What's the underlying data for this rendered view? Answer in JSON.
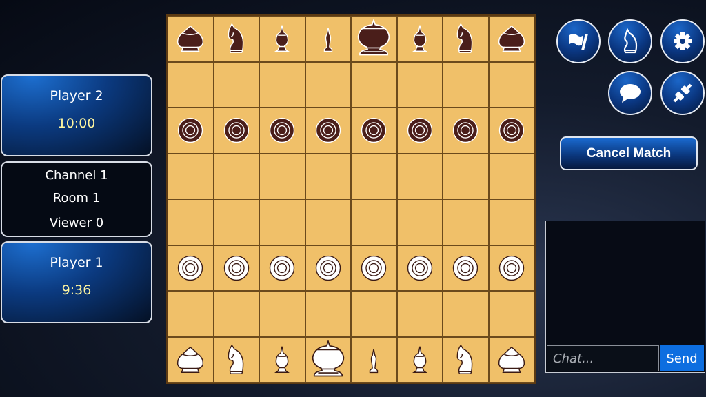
{
  "player2": {
    "name": "Player 2",
    "time": "10:00"
  },
  "room": {
    "channel": "Channel 1",
    "room": "Room 1",
    "viewers": "Viewer 0"
  },
  "player1": {
    "name": "Player 1",
    "time": "9:36"
  },
  "buttons": [
    {
      "icon": "flag-icon"
    },
    {
      "icon": "knight-icon"
    },
    {
      "icon": "gear-icon"
    },
    {
      "icon": "chat-bubble-icon"
    },
    {
      "icon": "disconnect-plug-icon"
    }
  ],
  "cancel_label": "Cancel Match",
  "chat": {
    "placeholder": "Chat...",
    "value": "",
    "send_label": "Send"
  },
  "colors": {
    "board": "#f0c069",
    "dark_piece": "#4a1e1a",
    "light_piece": "#ffffff",
    "accent": "#0d6ee0"
  },
  "board": [
    [
      "bR",
      "bN",
      "bB",
      "bQ",
      "bK",
      "bB",
      "bN",
      "bR"
    ],
    [
      "",
      "",
      "",
      "",
      "",
      "",
      "",
      ""
    ],
    [
      "bP",
      "bP",
      "bP",
      "bP",
      "bP",
      "bP",
      "bP",
      "bP"
    ],
    [
      "",
      "",
      "",
      "",
      "",
      "",
      "",
      ""
    ],
    [
      "",
      "",
      "",
      "",
      "",
      "",
      "",
      ""
    ],
    [
      "wP",
      "wP",
      "wP",
      "wP",
      "wP",
      "wP",
      "wP",
      "wP"
    ],
    [
      "",
      "",
      "",
      "",
      "",
      "",
      "",
      ""
    ],
    [
      "wR",
      "wN",
      "wB",
      "wK",
      "wQ",
      "wB",
      "wN",
      "wR"
    ]
  ]
}
